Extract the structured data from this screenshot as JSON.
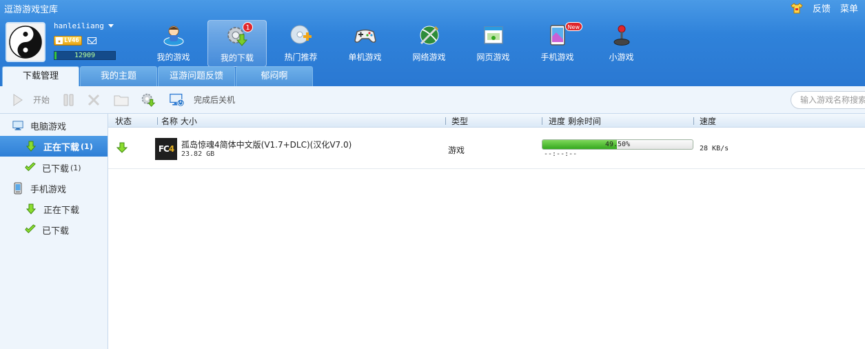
{
  "app": {
    "title": "逗游游戏宝库",
    "feedback_label": "反馈",
    "menu_label": "菜单"
  },
  "user": {
    "name": "hanleiliang",
    "level": "LV46",
    "points": "12909",
    "points_fraction": 0.03
  },
  "nav": {
    "items": [
      {
        "label": "我的游戏"
      },
      {
        "label": "我的下载",
        "badge": "1"
      },
      {
        "label": "热门推荐"
      },
      {
        "label": "单机游戏"
      },
      {
        "label": "网络游戏"
      },
      {
        "label": "网页游戏"
      },
      {
        "label": "手机游戏",
        "badge": "New"
      },
      {
        "label": "小游戏"
      }
    ]
  },
  "tabs": [
    {
      "label": "下载管理"
    },
    {
      "label": "我的主题"
    },
    {
      "label": "逗游问题反馈"
    },
    {
      "label": "郁闷啊"
    }
  ],
  "toolbar": {
    "start_label": "开始",
    "shutdown_label": "完成后关机",
    "search_placeholder": "输入游戏名称搜索"
  },
  "sidebar": {
    "pc_label": "电脑游戏",
    "pc_downloading": "正在下载",
    "pc_downloading_count": "(1)",
    "pc_downloaded": "已下载",
    "pc_downloaded_count": "(1)",
    "mobile_label": "手机游戏",
    "mobile_downloading": "正在下载",
    "mobile_downloaded": "已下载"
  },
  "table": {
    "headers": {
      "status": "状态",
      "name_size": "名称 大小",
      "type": "类型",
      "progress_time": "进度 剩余时间",
      "speed": "速度"
    },
    "rows": [
      {
        "logo_text": "FC",
        "logo_number": "4",
        "name": "孤岛惊魂4简体中文版(V1.7+DLC)(汉化V7.0)",
        "size": "23.82 GB",
        "type": "游戏",
        "progress": 0.495,
        "progress_label": "49.50%",
        "time_left": "--:--:--",
        "speed": "28 KB/s"
      }
    ]
  },
  "colors": {
    "header_blue": "#2f82da",
    "progress_green": "#34a81e",
    "badge_red": "#e0262b"
  }
}
